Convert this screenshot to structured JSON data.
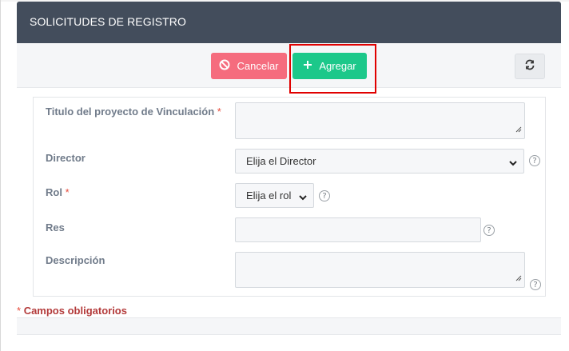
{
  "header": {
    "title": "SOLICITUDES DE REGISTRO"
  },
  "toolbar": {
    "cancel_label": "Cancelar",
    "add_label": "Agregar",
    "cancel_icon": "ban-icon",
    "add_icon": "plus-icon",
    "refresh_icon": "refresh-icon"
  },
  "form": {
    "titulo": {
      "label": "Titulo del proyecto de Vinculación",
      "required_mark": "*",
      "value": ""
    },
    "director": {
      "label": "Director",
      "selected": "Elija el Director",
      "help": "?"
    },
    "rol": {
      "label": "Rol",
      "required_mark": "*",
      "selected": "Elija el rol",
      "help": "?"
    },
    "res": {
      "label": "Res",
      "value": "",
      "help": "?"
    },
    "descripcion": {
      "label": "Descripción",
      "value": "",
      "help": "?"
    }
  },
  "footer": {
    "required_mark": "*",
    "required_note": "Campos obligatorios"
  },
  "colors": {
    "header_bg": "#434d5c",
    "cancel_bg": "#f56c7e",
    "add_bg": "#1cc88a",
    "highlight": "#e00000",
    "required": "#e74c3c"
  }
}
